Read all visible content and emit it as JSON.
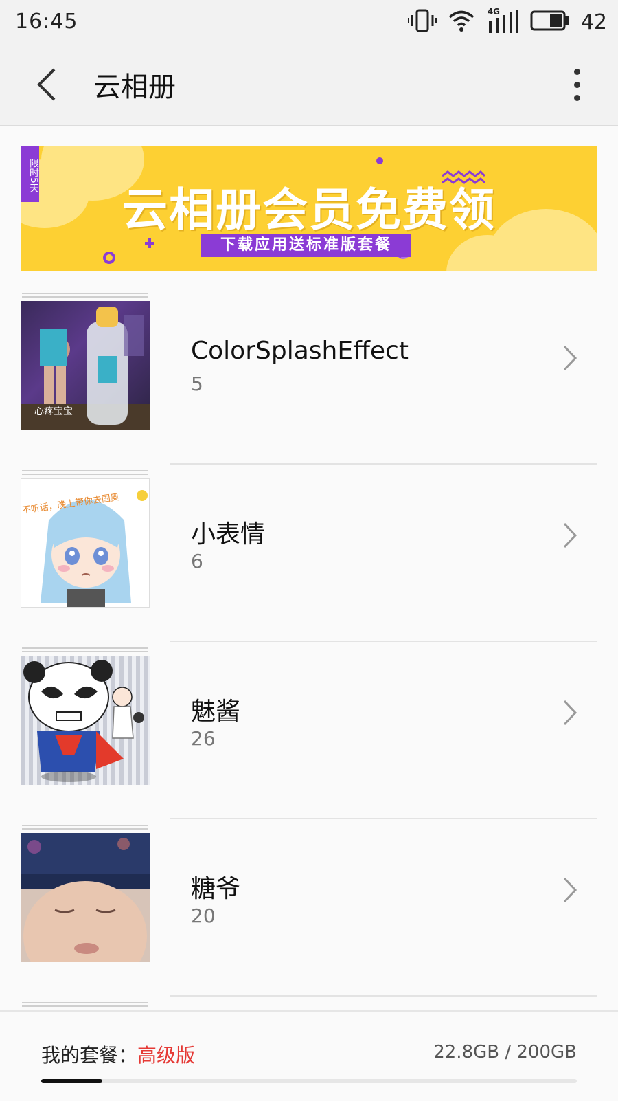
{
  "status_bar": {
    "time": "16:45",
    "network": "4G",
    "battery": "42"
  },
  "toolbar": {
    "title": "云相册"
  },
  "banner": {
    "tag": "限时5天",
    "title": "云相册会员免费领",
    "subtitle": "下载应用送标准版套餐",
    "colors": {
      "background": "#fdd033",
      "accent": "#8b3bd5"
    }
  },
  "albums": [
    {
      "name": "ColorSplashEffect",
      "count": "5",
      "thumb_caption": "心疼宝宝"
    },
    {
      "name": "小表情",
      "count": "6",
      "thumb_caption": "不听话，晚上带你去国奥"
    },
    {
      "name": "魅酱",
      "count": "26"
    },
    {
      "name": "糖爷",
      "count": "20"
    }
  ],
  "plan": {
    "label": "我的套餐：",
    "value": "高级版",
    "value_color": "#e53935",
    "storage": "22.8GB / 200GB",
    "storage_used_fraction": 0.114
  }
}
